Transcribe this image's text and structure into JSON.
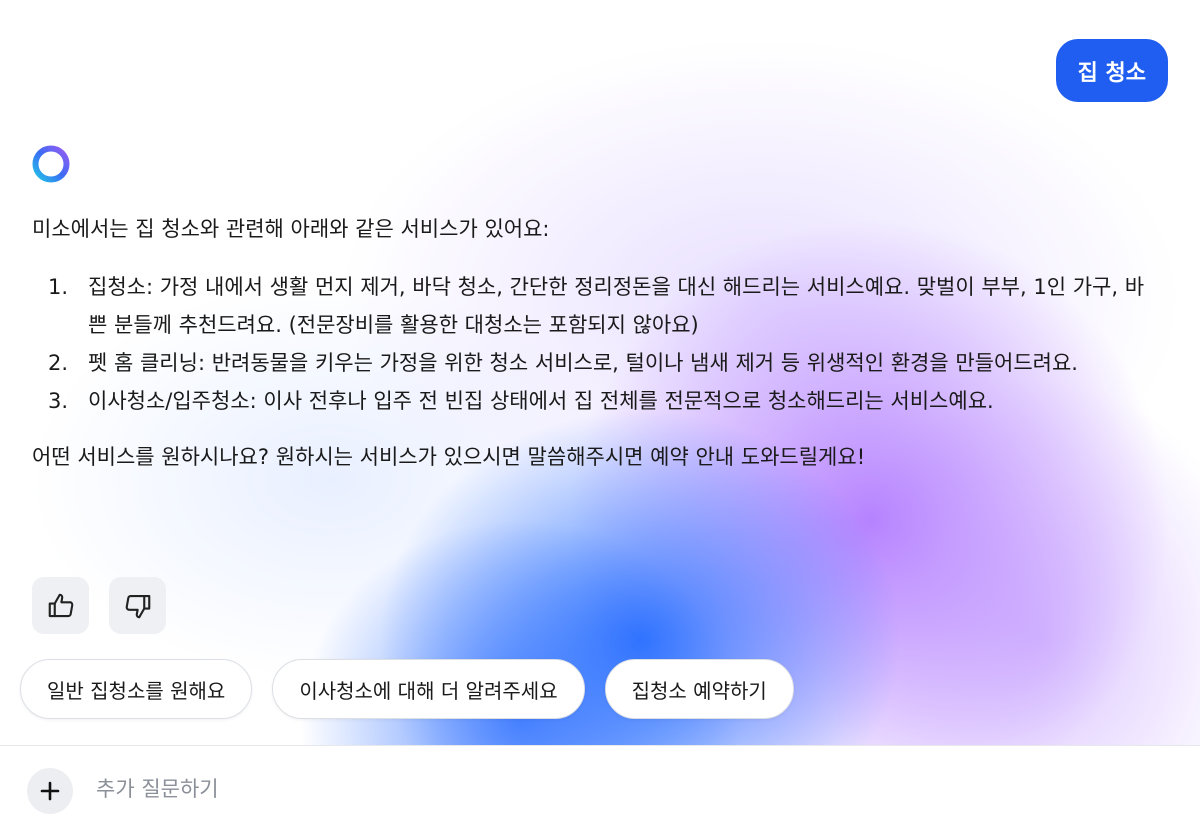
{
  "user_message": "집 청소",
  "assistant": {
    "intro": "미소에서는 집 청소와 관련해 아래와 같은 서비스가 있어요:",
    "services": [
      {
        "num": "1.",
        "text": "집청소: 가정 내에서 생활 먼지 제거, 바닥 청소, 간단한 정리정돈을 대신 해드리는 서비스예요. 맞벌이 부부, 1인 가구, 바쁜 분들께 추천드려요. (전문장비를 활용한 대청소는 포함되지 않아요)"
      },
      {
        "num": "2.",
        "text": "펫 홈 클리닝: 반려동물을 키우는 가정을 위한 청소 서비스로, 털이나 냄새 제거 등 위생적인 환경을 만들어드려요."
      },
      {
        "num": "3.",
        "text": "이사청소/입주청소: 이사 전후나 입주 전 빈집 상태에서 집 전체를 전문적으로 청소해드리는 서비스예요."
      }
    ],
    "closing": "어떤 서비스를 원하시나요? 원하시는 서비스가 있으시면 말씀해주시면 예약 안내 도와드릴게요!"
  },
  "feedback": {
    "like_icon": "thumbs-up-icon",
    "dislike_icon": "thumbs-down-icon"
  },
  "suggestions": [
    "일반 집청소를 원해요",
    "이사청소에 대해 더 알려주세요",
    "집청소 예약하기"
  ],
  "input": {
    "placeholder": "추가 질문하기",
    "add_icon": "plus-icon"
  },
  "colors": {
    "accent": "#1f5ef0",
    "chip_border": "#dcdfe4",
    "placeholder_text": "#8a8f98"
  }
}
